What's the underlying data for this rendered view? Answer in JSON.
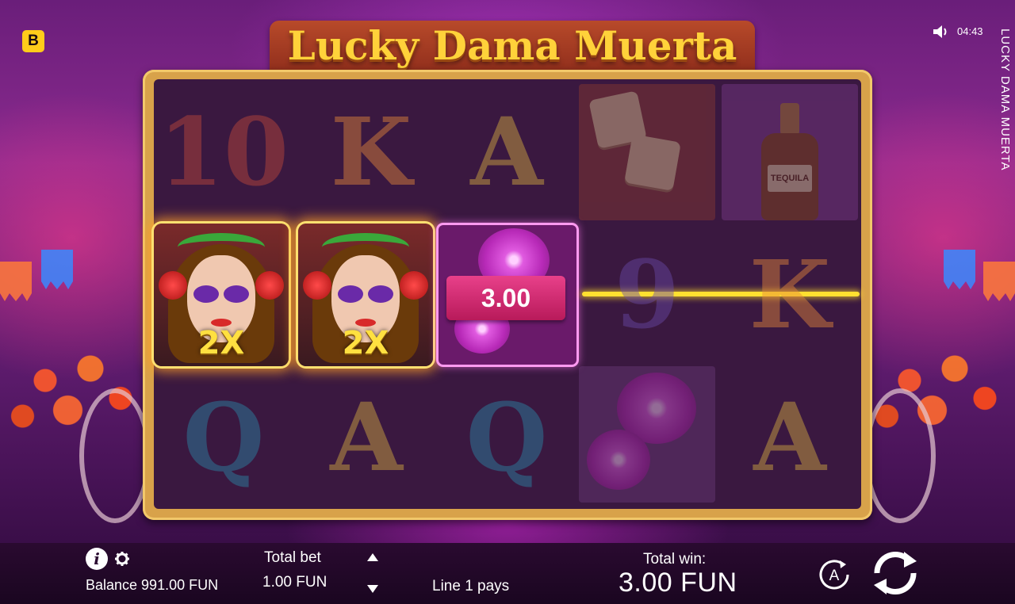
{
  "game": {
    "title": "Lucky Dama Muerta",
    "side_title": "LUCKY DAMA MUERTA",
    "logo": "B",
    "clock": "04:43"
  },
  "reels": {
    "row1": [
      "10",
      "K",
      "A"
    ],
    "row2": [
      "9",
      "K"
    ],
    "row3": [
      "Q",
      "A",
      "Q",
      "A"
    ],
    "wilds": [
      {
        "multiplier": "2X"
      },
      {
        "multiplier": "2X"
      }
    ],
    "tequila_label": "TEQUILA",
    "line_win": "3.00"
  },
  "bottom_bar": {
    "balance": "Balance 991.00 FUN",
    "total_bet_label": "Total bet",
    "total_bet_value": "1.00 FUN",
    "line_message": "Line 1 pays",
    "total_win_label": "Total win:",
    "total_win_value": "3.00 FUN",
    "autoplay_letter": "A"
  },
  "colors": {
    "accent_gold": "#ffd23a",
    "payline": "#ffe030",
    "ribbon": "#e8408a",
    "bar_bg": "#1a0620"
  },
  "icons": [
    "info-icon",
    "gear-icon",
    "sound-icon",
    "arrow-up-icon",
    "arrow-down-icon",
    "autoplay-icon",
    "spin-icon"
  ]
}
